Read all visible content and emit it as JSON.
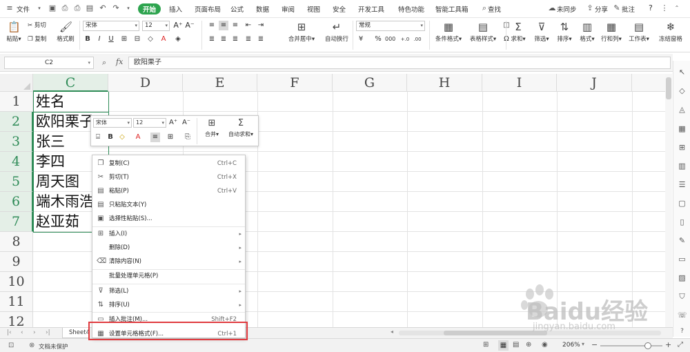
{
  "menubar": {
    "file_label": "文件",
    "tabs": [
      "开始",
      "插入",
      "页面布局",
      "公式",
      "数据",
      "审阅",
      "视图",
      "安全",
      "开发工具",
      "特色功能",
      "智能工具箱"
    ],
    "active_tab": "开始",
    "search_label": "查找",
    "sync_label": "未同步",
    "share_label": "分享",
    "comment_label": "批注",
    "help_label": "?"
  },
  "ribbon": {
    "paste": "粘贴",
    "cut": "剪切",
    "copy": "复制",
    "format_painter": "格式刷",
    "font_name": "宋体",
    "font_size": "12",
    "merge_center": "合并居中",
    "auto_wrap": "自动换行",
    "number_format": "常规",
    "cond_format": "条件格式",
    "table_style": "表格样式",
    "sum": "求和",
    "filter": "筛选",
    "sort": "排序",
    "format": "格式",
    "row_col": "行和列",
    "worksheet": "工作表",
    "freeze": "冻结窗格"
  },
  "formula_bar": {
    "name_box": "C2",
    "fx_label": "fx",
    "content": "欧阳栗子"
  },
  "grid": {
    "columns": [
      "C",
      "D",
      "E",
      "F",
      "G",
      "H",
      "I",
      "J"
    ],
    "selected_column": "C",
    "rows": [
      "1",
      "2",
      "3",
      "4",
      "5",
      "6",
      "7",
      "8",
      "9",
      "10",
      "11",
      "12"
    ],
    "selected_rows": [
      "2",
      "3",
      "4",
      "5",
      "6",
      "7"
    ],
    "cells": [
      "姓名",
      "欧阳栗子",
      "张三",
      "李四",
      "周天图",
      "端木雨浩",
      "赵亚茹"
    ]
  },
  "mini_toolbar": {
    "font_name": "宋体",
    "font_size": "12",
    "merge": "合并",
    "autosum": "自动求和"
  },
  "context_menu": {
    "items": [
      {
        "label": "复制(C)",
        "key": "Ctrl+C",
        "icon": "copy-icon"
      },
      {
        "label": "剪切(T)",
        "key": "Ctrl+X",
        "icon": "scissors-icon"
      },
      {
        "label": "粘贴(P)",
        "key": "Ctrl+V",
        "icon": "paste-icon"
      },
      {
        "label": "只粘贴文本(Y)",
        "key": "",
        "icon": "paste-text-icon"
      },
      {
        "label": "选择性粘贴(S)...",
        "key": "",
        "icon": "paste-special-icon"
      },
      {
        "label": "插入(I)",
        "key": "",
        "icon": "insert-icon"
      },
      {
        "label": "删除(D)",
        "key": "",
        "icon": ""
      },
      {
        "label": "清除内容(N)",
        "key": "",
        "icon": "eraser-icon"
      },
      {
        "label": "批量处理单元格(P)",
        "key": "",
        "icon": ""
      },
      {
        "label": "筛选(L)",
        "key": "",
        "icon": "filter-icon"
      },
      {
        "label": "排序(U)",
        "key": "",
        "icon": "sort-icon"
      },
      {
        "label": "插入批注(M)...",
        "key": "Shift+F2",
        "icon": "comment-icon"
      },
      {
        "label": "设置单元格格式(F)...",
        "key": "Ctrl+1",
        "icon": "format-cells-icon"
      }
    ]
  },
  "sheet_tab": "Sheet4",
  "status": {
    "doc_protect": "文档未保护",
    "zoom": "206%"
  },
  "watermark": {
    "brand": "Baidu经验",
    "url": "jingyan.baidu.com"
  },
  "colors": {
    "accent_green": "#2ea44f",
    "selection_green": "#2e8b57",
    "highlight_red": "#e0393e"
  }
}
